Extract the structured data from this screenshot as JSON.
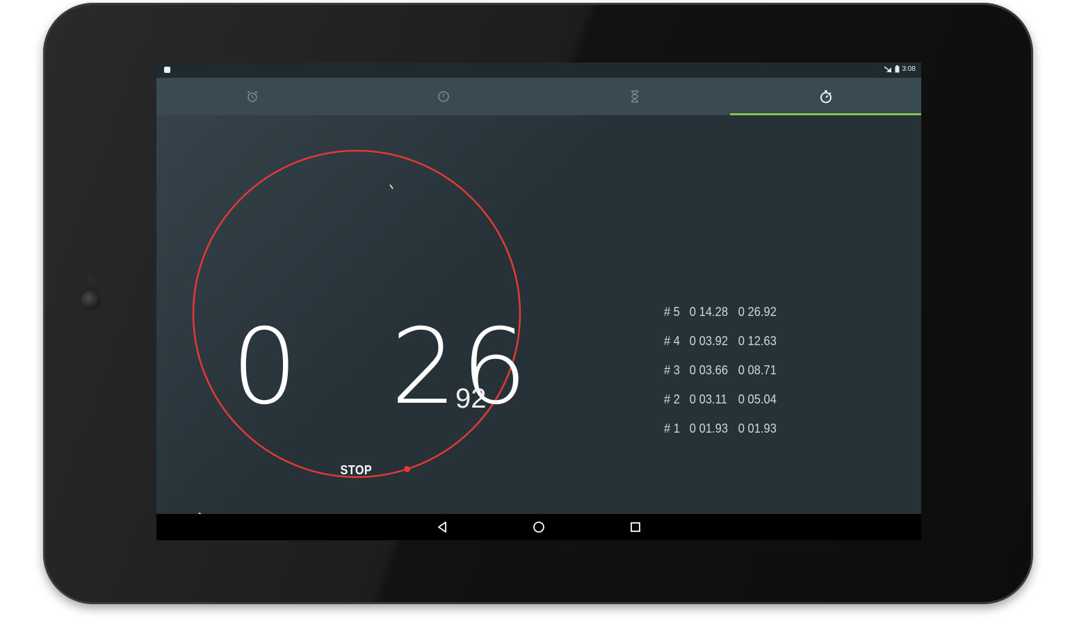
{
  "status_bar": {
    "time": "3:08",
    "icons": [
      "notification-icon",
      "signal-icon",
      "battery-icon"
    ]
  },
  "tabs": [
    {
      "icon": "alarm-clock-icon",
      "active": false
    },
    {
      "icon": "clock-icon",
      "active": false
    },
    {
      "icon": "hourglass-timer-icon",
      "active": false
    },
    {
      "icon": "stopwatch-icon",
      "active": true
    }
  ],
  "stopwatch": {
    "minutes": "0",
    "seconds": "26",
    "hundredths": "92",
    "primary_button": "STOP",
    "progress_fraction": 0.45
  },
  "laps": [
    {
      "number": "# 5",
      "lap_time": "0 14.28",
      "total_time": "0 26.92"
    },
    {
      "number": "# 4",
      "lap_time": "0 03.92",
      "total_time": "0 12.63"
    },
    {
      "number": "# 3",
      "lap_time": "0 03.66",
      "total_time": "0 08.71"
    },
    {
      "number": "# 2",
      "lap_time": "0 03.11",
      "total_time": "0 05.04"
    },
    {
      "number": "# 1",
      "lap_time": "0 01.93",
      "total_time": "0 01.93"
    }
  ],
  "colors": {
    "accent": "#8bc34a",
    "ring": "#e53935",
    "background": "#263238"
  }
}
